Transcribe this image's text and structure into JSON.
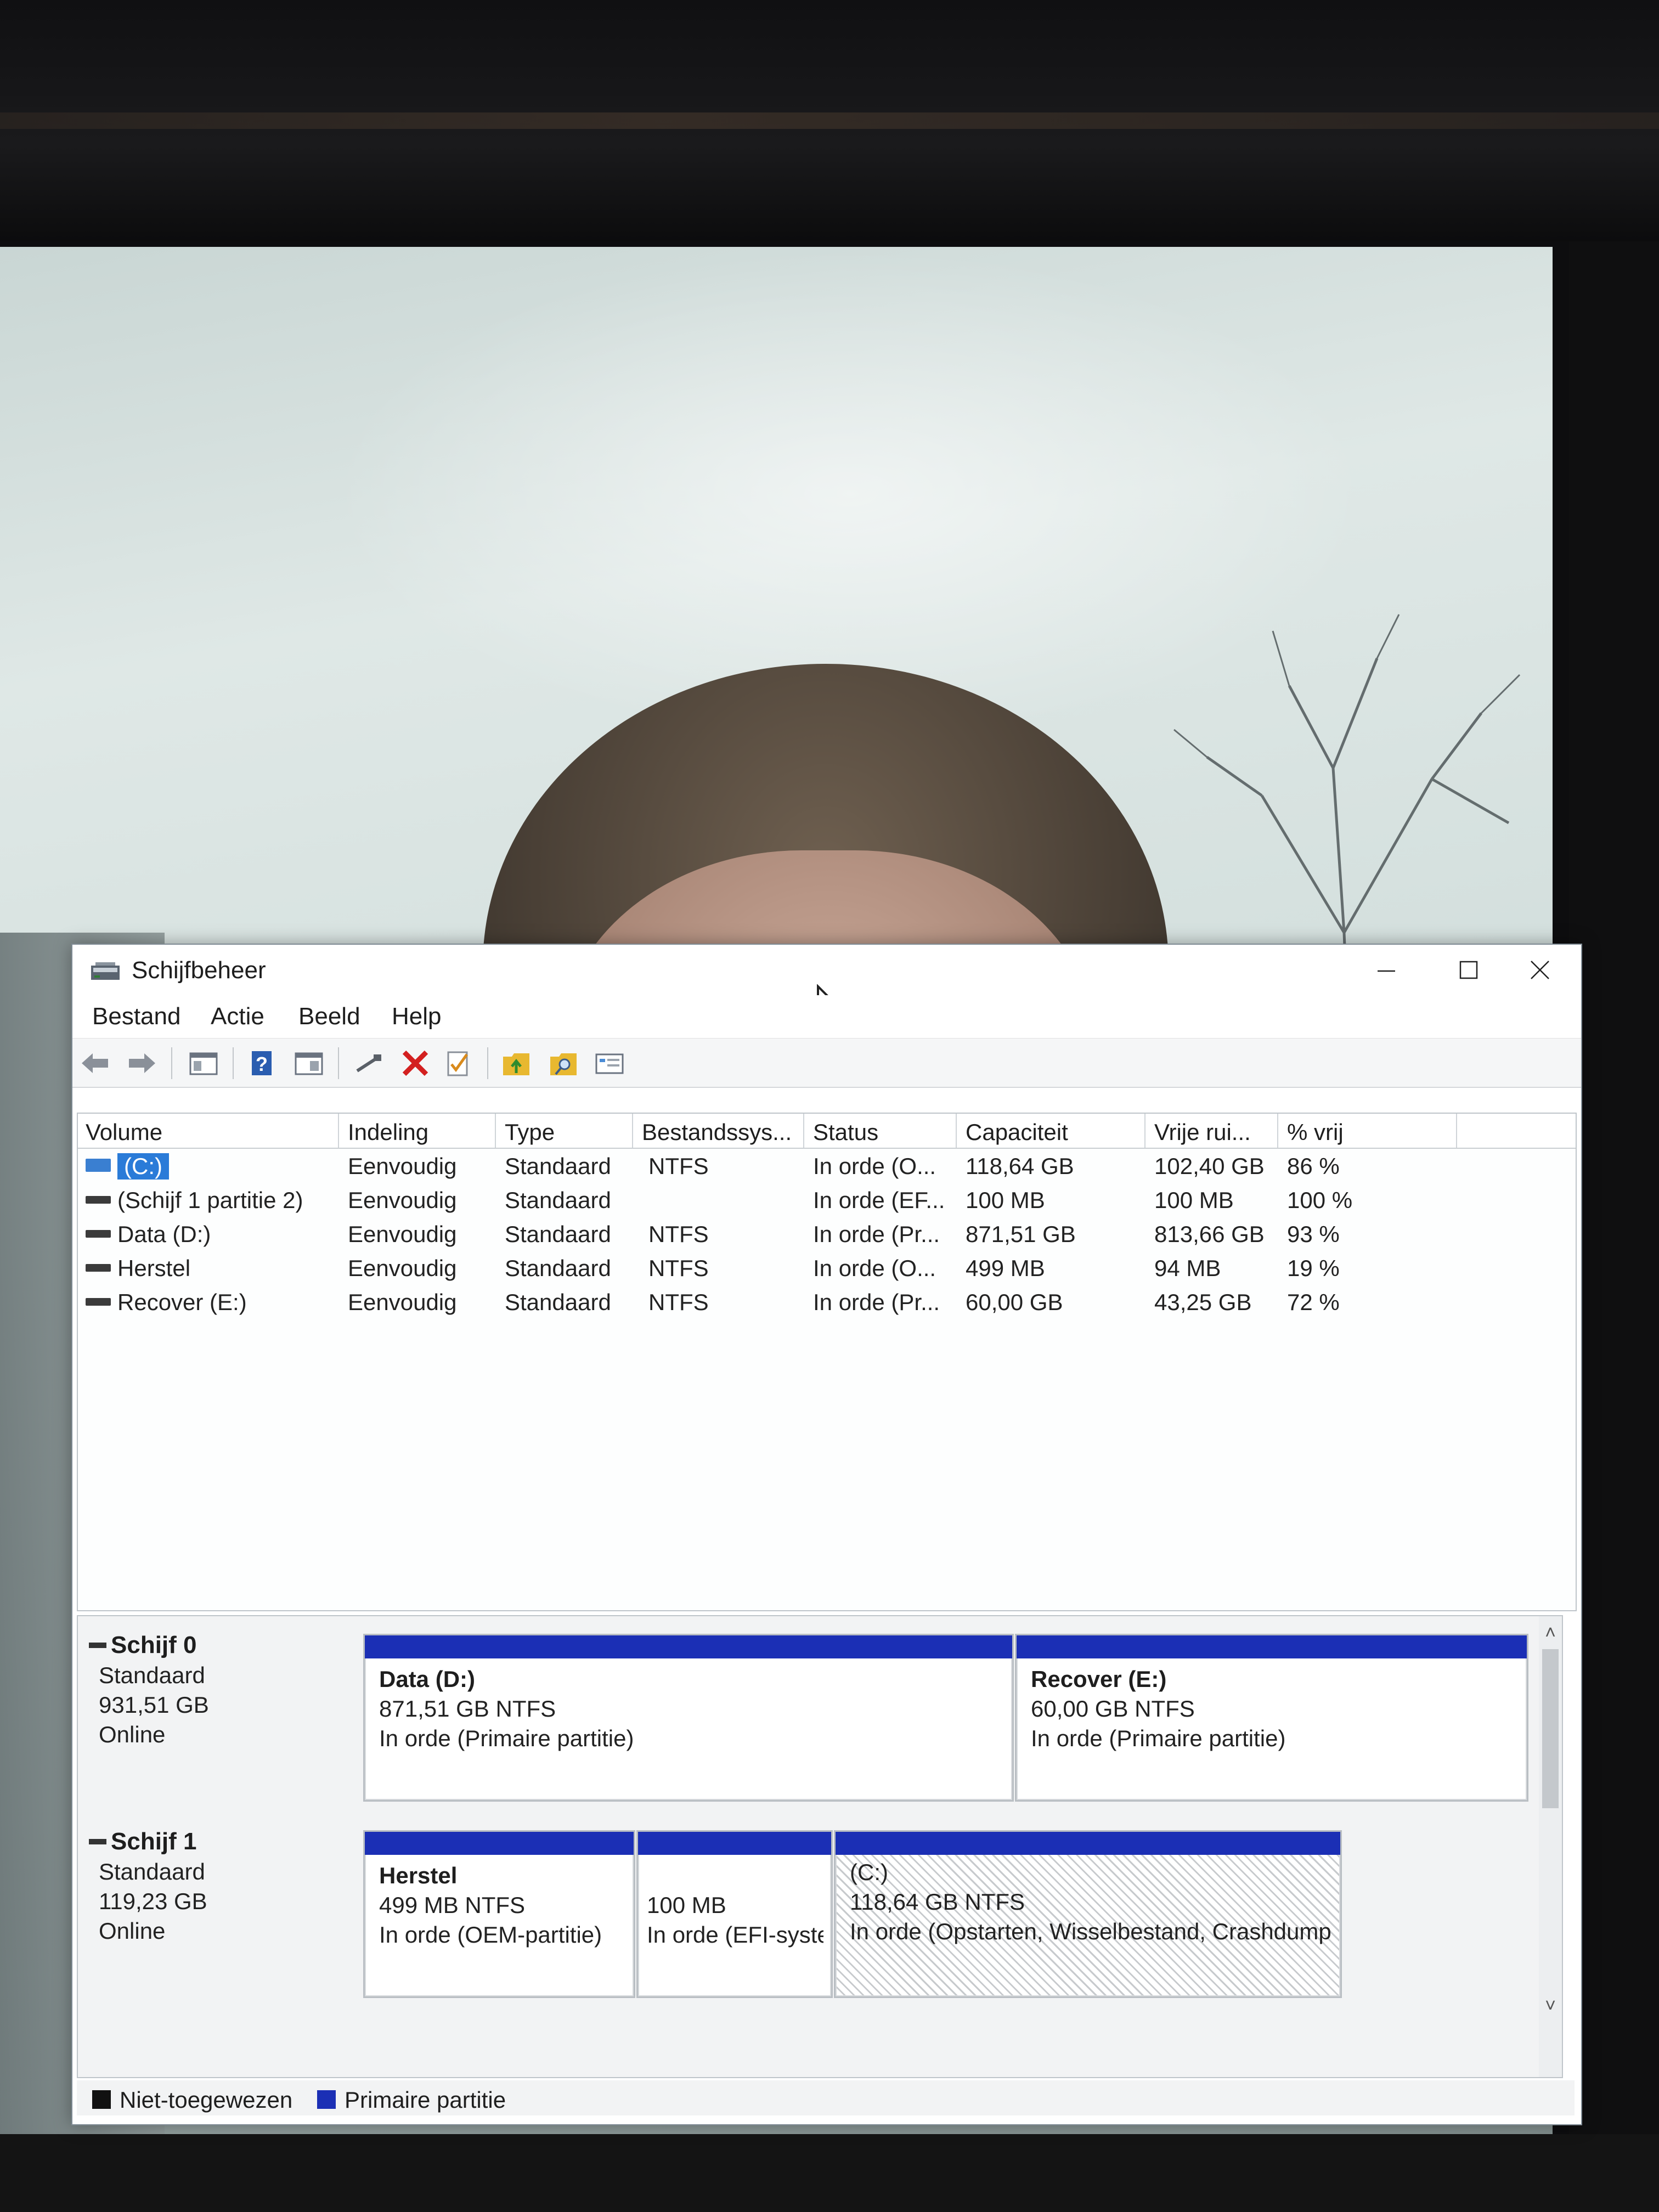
{
  "window": {
    "title": "Schijfbeheer"
  },
  "menu": {
    "items": [
      "Bestand",
      "Actie",
      "Beeld",
      "Help"
    ]
  },
  "toolbar": {
    "icons": [
      "back-arrow-icon",
      "forward-arrow-icon",
      "show-hide-tree-icon",
      "help-icon",
      "properties-icon",
      "connect-icon",
      "delete-icon",
      "check-icon",
      "up-folder-icon",
      "search-folder-icon",
      "console-icon"
    ]
  },
  "volumes": {
    "columns": [
      "Volume",
      "Indeling",
      "Type",
      "Bestandssys...",
      "Status",
      "Capaciteit",
      "Vrije rui...",
      "% vrij"
    ],
    "rows": [
      {
        "volume": "(C:)",
        "indeling": "Eenvoudig",
        "type": "Standaard",
        "fs": "NTFS",
        "status": "In orde (O...",
        "capaciteit": "118,64 GB",
        "vrij": "102,40 GB",
        "pct": "86 %",
        "selected": true
      },
      {
        "volume": "(Schijf 1 partitie 2)",
        "indeling": "Eenvoudig",
        "type": "Standaard",
        "fs": "",
        "status": "In orde (EF...",
        "capaciteit": "100 MB",
        "vrij": "100 MB",
        "pct": "100 %",
        "selected": false
      },
      {
        "volume": "Data (D:)",
        "indeling": "Eenvoudig",
        "type": "Standaard",
        "fs": "NTFS",
        "status": "In orde (Pr...",
        "capaciteit": "871,51 GB",
        "vrij": "813,66 GB",
        "pct": "93 %",
        "selected": false
      },
      {
        "volume": "Herstel",
        "indeling": "Eenvoudig",
        "type": "Standaard",
        "fs": "NTFS",
        "status": "In orde (O...",
        "capaciteit": "499 MB",
        "vrij": "94 MB",
        "pct": "19 %",
        "selected": false
      },
      {
        "volume": "Recover (E:)",
        "indeling": "Eenvoudig",
        "type": "Standaard",
        "fs": "NTFS",
        "status": "In orde (Pr...",
        "capaciteit": "60,00 GB",
        "vrij": "43,25 GB",
        "pct": "72 %",
        "selected": false
      }
    ]
  },
  "disks": [
    {
      "name": "Schijf 0",
      "type": "Standaard",
      "size": "931,51 GB",
      "state": "Online",
      "partitions": [
        {
          "title": "Data  (D:)",
          "size": "871,51 GB NTFS",
          "status": "In orde (Primaire partitie)"
        },
        {
          "title": "Recover  (E:)",
          "size": "60,00 GB NTFS",
          "status": "In orde (Primaire partitie)"
        }
      ]
    },
    {
      "name": "Schijf 1",
      "type": "Standaard",
      "size": "119,23 GB",
      "state": "Online",
      "partitions": [
        {
          "title": "Herstel",
          "size": "499 MB NTFS",
          "status": "In orde (OEM-partitie)"
        },
        {
          "title": "",
          "size": "100 MB",
          "status": "In orde (EFI-systeempartitie)"
        },
        {
          "title": "(C:)",
          "size": "118,64 GB NTFS",
          "status": "In orde (Opstarten, Wisselbestand, Crashdump, Primaire partitie)"
        }
      ]
    }
  ],
  "legend": {
    "unallocated": "Niet-toegewezen",
    "primary": "Primaire partitie",
    "unallocated_color": "#111111",
    "primary_color": "#1b2fb5"
  }
}
